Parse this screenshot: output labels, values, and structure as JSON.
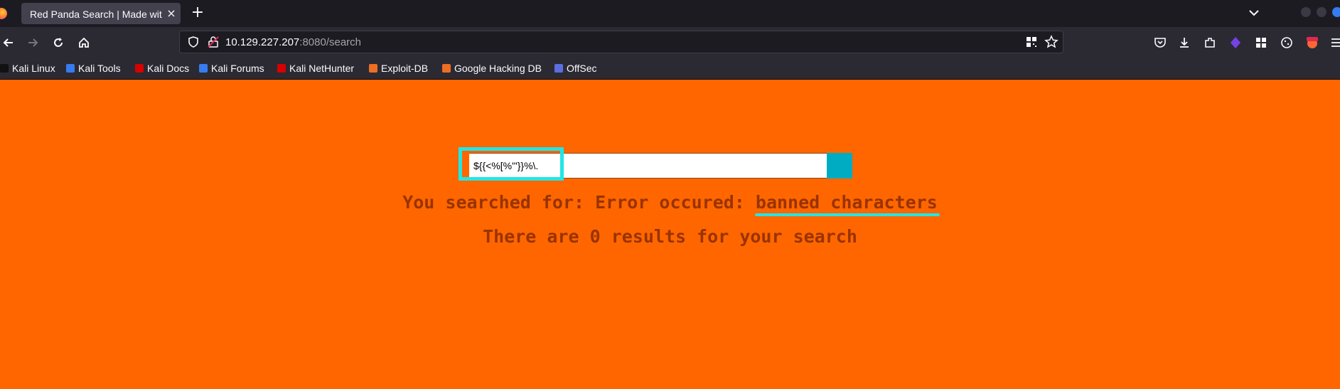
{
  "browser": {
    "tab_title": "Red Panda Search | Made with Spring Boot",
    "tab_close": "×",
    "new_tab": "+",
    "url_host": "10.129.227.207",
    "url_rest": ":8080/search"
  },
  "bookmarks": [
    {
      "label": "Kali Linux",
      "color": "#1f1f1f"
    },
    {
      "label": "Kali Tools",
      "color": "#367bf0"
    },
    {
      "label": "Kali Docs",
      "color": "#d70000"
    },
    {
      "label": "Kali Forums",
      "color": "#367bf0"
    },
    {
      "label": "Kali NetHunter",
      "color": "#d70000"
    },
    {
      "label": "Exploit-DB",
      "color": "#ec6f23"
    },
    {
      "label": "Google Hacking DB",
      "color": "#ec6f23"
    },
    {
      "label": "OffSec",
      "color": "#5b6ee1"
    }
  ],
  "page": {
    "search_value": "${{<%[%'\"}}%\\.",
    "searched_prefix": "You searched for: Error occured: ",
    "searched_error": "banned characters",
    "results_text": "There are 0 results for your search",
    "colors": {
      "background": "#ff6600",
      "text": "#993300",
      "button": "#00acc1",
      "highlight": "#21e6e6"
    }
  }
}
